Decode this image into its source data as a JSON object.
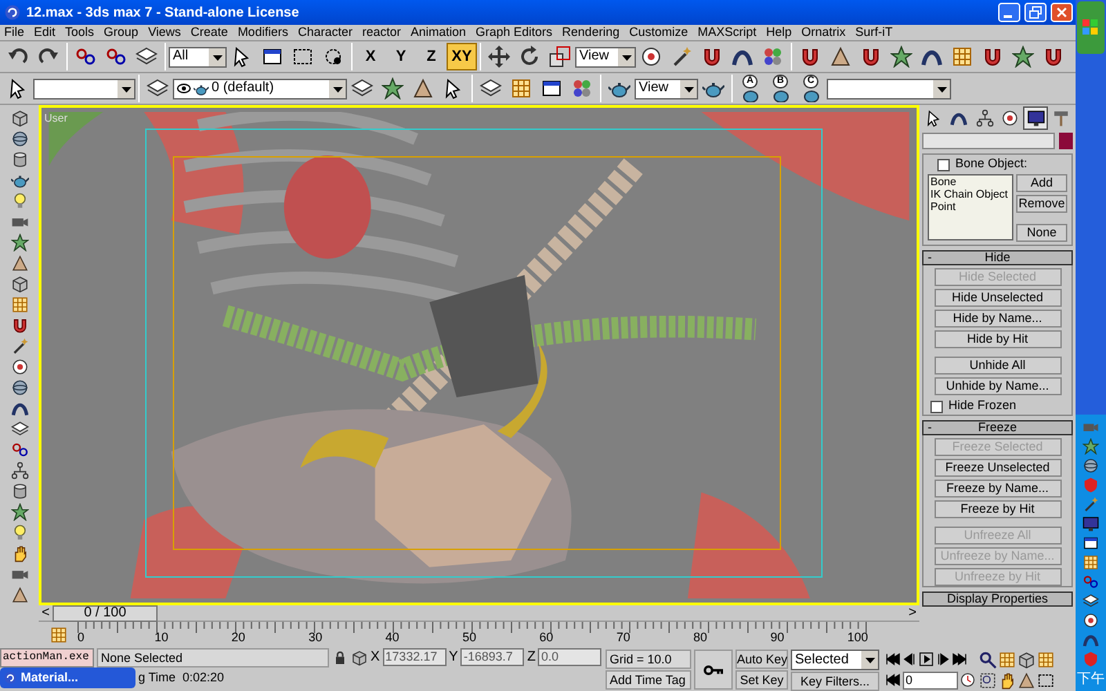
{
  "window": {
    "title": "12.max - 3ds max 7  - Stand-alone License"
  },
  "menu": [
    "File",
    "Edit",
    "Tools",
    "Group",
    "Views",
    "Create",
    "Modifiers",
    "Character",
    "reactor",
    "Animation",
    "Graph Editors",
    "Rendering",
    "Customize",
    "MAXScript",
    "Help",
    "Ornatrix",
    "Surf-iT"
  ],
  "main_toolbar": {
    "selection_filter": "All",
    "axis_buttons": [
      {
        "label": "X",
        "selected": false
      },
      {
        "label": "Y",
        "selected": false
      },
      {
        "label": "Z",
        "selected": false
      },
      {
        "label": "XY",
        "selected": true
      }
    ],
    "coordinate_system": "View"
  },
  "second_toolbar": {
    "layer": "0 (default)",
    "view_dropdown": "View",
    "render_presets": [
      "A",
      "B",
      "C"
    ]
  },
  "viewport": {
    "label": "User"
  },
  "command_panel": {
    "tabs": [
      {
        "selected": false
      },
      {
        "selected": false
      },
      {
        "selected": false
      },
      {
        "selected": false
      },
      {
        "selected": true
      },
      {
        "selected": false
      }
    ],
    "bone_object": {
      "label": "Bone Object:",
      "checked": false
    },
    "object_types": [
      "Bone",
      "IK Chain Object",
      "Point"
    ],
    "type_buttons": [
      "Add",
      "Remove",
      "None"
    ],
    "rollouts": [
      {
        "toggle": "-",
        "title": "Hide",
        "button_groups": [
          [
            {
              "label": "Hide Selected",
              "disabled": true
            },
            {
              "label": "Hide Unselected",
              "disabled": false
            },
            {
              "label": "Hide by Name...",
              "disabled": false
            },
            {
              "label": "Hide by Hit",
              "disabled": false
            }
          ],
          [
            {
              "label": "Unhide All",
              "disabled": false
            },
            {
              "label": "Unhide by Name...",
              "disabled": false
            }
          ]
        ],
        "checkbox": {
          "label": "Hide Frozen",
          "checked": false
        }
      },
      {
        "toggle": "-",
        "title": "Freeze",
        "button_groups": [
          [
            {
              "label": "Freeze Selected",
              "disabled": true
            },
            {
              "label": "Freeze Unselected",
              "disabled": false
            },
            {
              "label": "Freeze by Name...",
              "disabled": false
            },
            {
              "label": "Freeze by Hit",
              "disabled": false
            }
          ],
          [
            {
              "label": "Unfreeze All",
              "disabled": true
            },
            {
              "label": "Unfreeze by Name...",
              "disabled": true
            },
            {
              "label": "Unfreeze by Hit",
              "disabled": true
            }
          ]
        ]
      },
      {
        "title": "Display Properties"
      }
    ]
  },
  "time_slider": {
    "label": "0 / 100",
    "prev": "<",
    "next": ">",
    "level": 0
  },
  "track_bar": {
    "labels": [
      "0",
      "10",
      "20",
      "30",
      "40",
      "50",
      "60",
      "70",
      "80",
      "90",
      "100"
    ]
  },
  "status": {
    "task": "actionMan.exe",
    "selection": "None Selected",
    "coordinates": [
      {
        "axis": "X",
        "value": "17332.17"
      },
      {
        "axis": "Y",
        "value": "-16893.7"
      },
      {
        "axis": "Z",
        "value": "0.0"
      }
    ],
    "grid": "Grid = 10.0",
    "render_time_label": "g Time",
    "render_time": "0:02:20",
    "add_time_tag": "Add Time Tag"
  },
  "animation": {
    "auto_key": {
      "label": "Auto Key",
      "on": false
    },
    "set_key": "Set Key",
    "key_mode": "Selected",
    "key_filters": "Key Filters...",
    "frame": "0"
  },
  "taskbar": {
    "window_button": "Material...",
    "clock": "下午"
  }
}
